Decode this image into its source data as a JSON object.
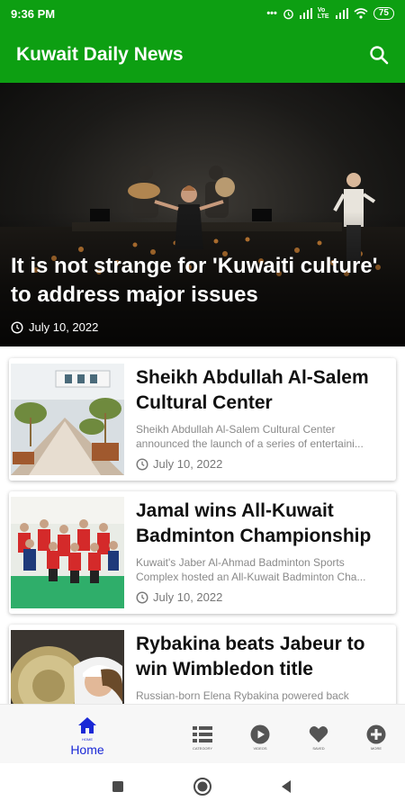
{
  "status_bar": {
    "time": "9:36 PM",
    "network": "Vo LTE",
    "battery": "75"
  },
  "app_bar": {
    "title": "Kuwait Daily News"
  },
  "hero": {
    "title": "It is not strange for 'Kuwaiti culture' to address major issues",
    "date": "July 10, 2022"
  },
  "articles": [
    {
      "title": "Sheikh Abdullah Al-Salem Cultural Center",
      "excerpt": "Sheikh Abdullah Al-Salem Cultural Center announced the launch of a series of entertaini...",
      "date": "July 10, 2022"
    },
    {
      "title": "Jamal wins All-Kuwait Badminton Championship",
      "excerpt": "Kuwait's Jaber Al-Ahmad Badminton Sports Complex hosted an All-Kuwait Badminton Cha...",
      "date": "July 10, 2022"
    },
    {
      "title": "Rybakina beats Jabeur to win Wimbledon title",
      "excerpt": "Russian-born Elena Rybakina powered back",
      "date": ""
    }
  ],
  "bottom_nav": {
    "items": [
      {
        "label": "Home",
        "tiny": "HOME",
        "icon": "home-icon",
        "active": true
      },
      {
        "label": "",
        "tiny": "CATEGORY",
        "icon": "list-icon",
        "active": false
      },
      {
        "label": "",
        "tiny": "VIDEOS",
        "icon": "play-icon",
        "active": false
      },
      {
        "label": "",
        "tiny": "SAVED",
        "icon": "heart-icon",
        "active": false
      },
      {
        "label": "",
        "tiny": "MORE",
        "icon": "plus-circle-icon",
        "active": false
      }
    ]
  },
  "colors": {
    "primary": "#0d9f12",
    "active_nav": "#1a28d6"
  }
}
